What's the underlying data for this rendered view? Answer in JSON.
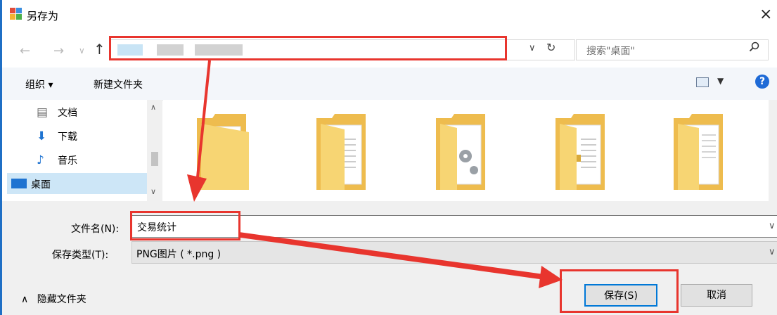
{
  "window": {
    "title": "另存为",
    "close_glyph": "×"
  },
  "address_bar": {
    "dropdown_glyph": "∨",
    "refresh_glyph": "↻"
  },
  "search": {
    "placeholder": "搜索\"桌面\"",
    "icon": "search-icon"
  },
  "toolbar": {
    "organize_label": "组织 ▾",
    "new_folder_label": "新建文件夹",
    "help_glyph": "?"
  },
  "nav_pane": {
    "items": [
      {
        "label": "文档",
        "icon": "document-icon",
        "selected": false
      },
      {
        "label": "下载",
        "icon": "download-icon",
        "selected": false
      },
      {
        "label": "音乐",
        "icon": "music-icon",
        "selected": false
      },
      {
        "label": "桌面",
        "icon": "desktop-icon",
        "selected": true
      }
    ]
  },
  "form": {
    "filename_label": "文件名(N):",
    "filename_value": "交易统计",
    "filetype_label": "保存类型(T):",
    "filetype_value": "PNG图片 ( *.png )"
  },
  "footer": {
    "hide_folders_label": "隐藏文件夹",
    "save_label": "保存(S)",
    "cancel_label": "取消"
  },
  "colors": {
    "accent": "#0078d7",
    "annotation": "#e8352e",
    "folder": "#f5c85e"
  }
}
